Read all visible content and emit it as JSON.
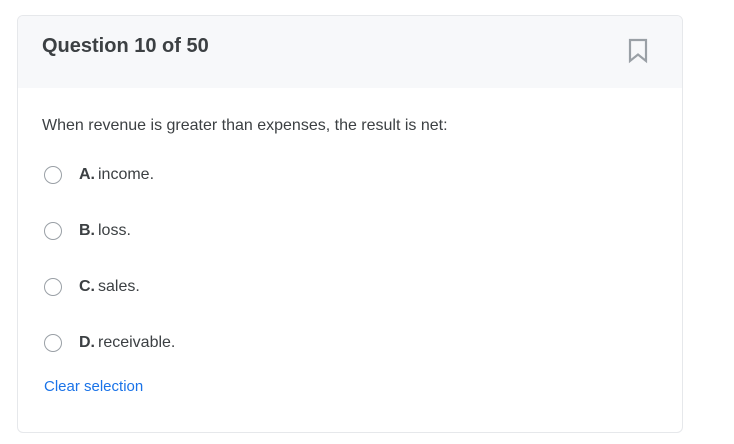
{
  "header": {
    "title": "Question 10 of 50"
  },
  "question": {
    "text": "When revenue is greater than expenses, the result is net:"
  },
  "options": [
    {
      "letter": "A.",
      "text": "income."
    },
    {
      "letter": "B.",
      "text": "loss."
    },
    {
      "letter": "C.",
      "text": "sales."
    },
    {
      "letter": "D.",
      "text": "receivable."
    }
  ],
  "actions": {
    "clear_label": "Clear selection"
  },
  "icons": {
    "bookmark": "bookmark-icon",
    "radio": "radio-unchecked-icon"
  },
  "colors": {
    "link": "#1a73e8",
    "header_bg": "#f7f8fa",
    "text": "#3c4043",
    "icon": "#9aa0a6"
  }
}
